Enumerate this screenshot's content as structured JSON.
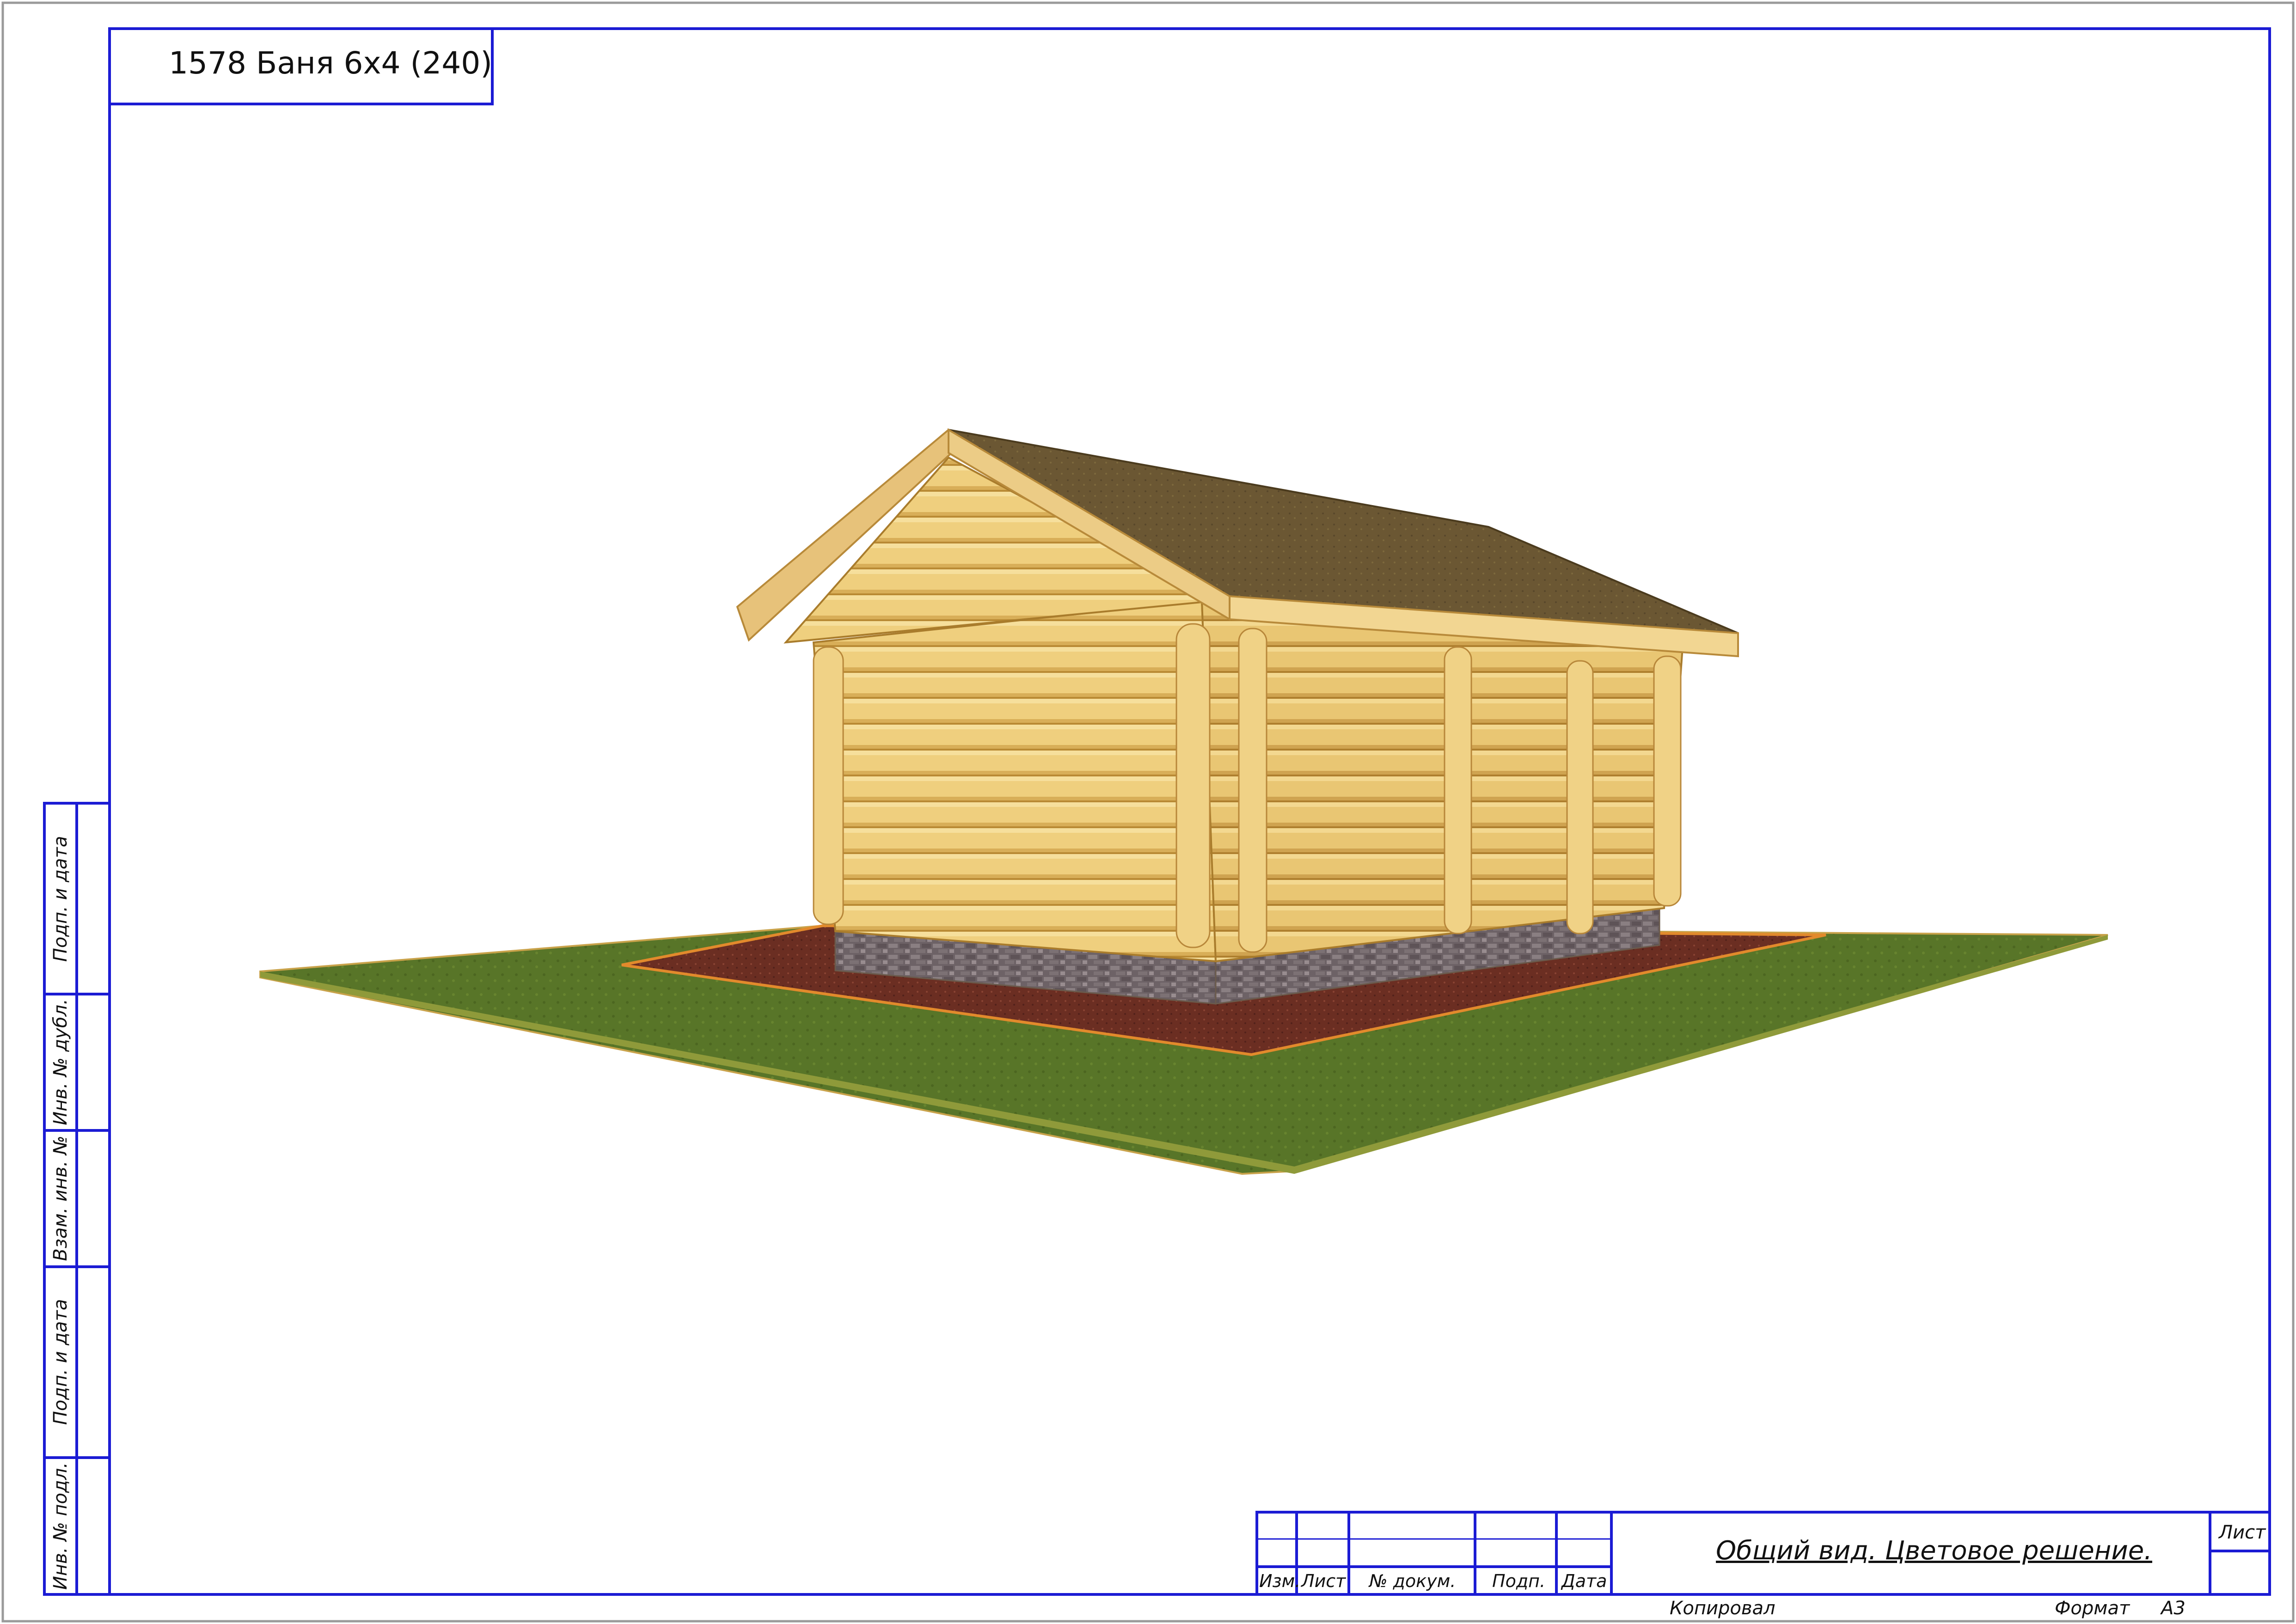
{
  "header": {
    "project_title": "1578 Баня 6x4 (240)"
  },
  "side_stamp": [
    {
      "label": "Подп. и дата"
    },
    {
      "label": "Инв. № дубл."
    },
    {
      "label": "Взам. инв. №"
    },
    {
      "label": "Подп. и дата"
    },
    {
      "label": "Инв. № подл."
    }
  ],
  "title_block": {
    "columns": [
      "Изм.",
      "Лист",
      "№ докум.",
      "Подп.",
      "Дата"
    ],
    "sheet_title": "Общий вид. Цветовое решение.",
    "sheet_label": "Лист",
    "copied_label": "Копировал",
    "format_label": "Формат",
    "format_value": "А3"
  },
  "colors": {
    "frame": "#1b1bd4",
    "log_light": "#f2d588",
    "log_mid": "#e6be62",
    "log_shadow": "#c99a3c",
    "roof": "#6e5a34",
    "roof_edge": "#b88a3a",
    "ground": "#567226",
    "gravel": "#6b2e22",
    "plinth": "#6f6468"
  }
}
